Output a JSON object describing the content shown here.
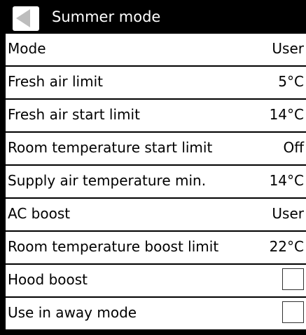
{
  "header": {
    "title": "Summer mode",
    "back_icon": "back-arrow-icon"
  },
  "rows": [
    {
      "label": "Mode",
      "value": "User"
    },
    {
      "label": "Fresh air limit",
      "value": "5°C"
    },
    {
      "label": "Fresh air start limit",
      "value": "14°C"
    },
    {
      "label": "Room temperature start limit",
      "value": "Off"
    },
    {
      "label": "Supply air temperature min.",
      "value": "14°C"
    },
    {
      "label": "AC boost",
      "value": "User"
    },
    {
      "label": "Room temperature boost limit",
      "value": "22°C"
    },
    {
      "label": "Hood boost",
      "checked": false
    },
    {
      "label": "Use in away mode",
      "checked": false
    }
  ],
  "colors": {
    "background": "#000000",
    "row": "#ffffff",
    "back_arrow": "#bdbdbd"
  }
}
